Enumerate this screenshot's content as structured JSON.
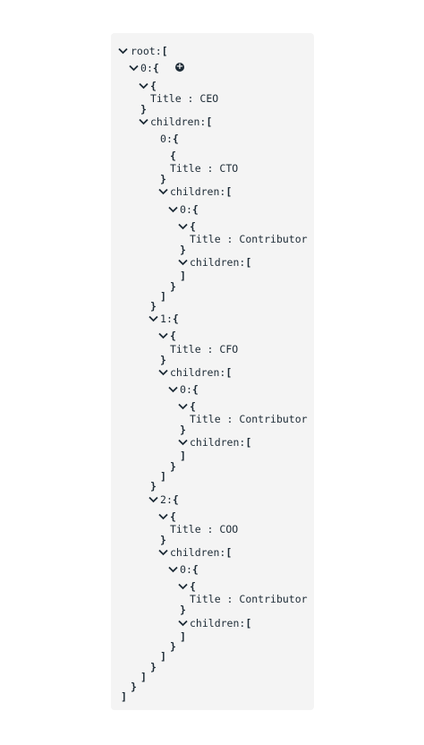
{
  "tree": {
    "root_key": "root",
    "key_sep": ":",
    "open_array": "[",
    "close_array": "]",
    "open_object": "{",
    "close_object": "}",
    "title_key": "Title",
    "title_sep": " : ",
    "children_key": "children",
    "ceo": {
      "index": "0",
      "title": "CEO"
    },
    "reports": [
      {
        "index": "0",
        "title": "CTO",
        "contributor": {
          "index": "0",
          "title": "Contributor"
        }
      },
      {
        "index": "1",
        "title": "CFO",
        "contributor": {
          "index": "0",
          "title": "Contributor"
        }
      },
      {
        "index": "2",
        "title": "COO",
        "contributor": {
          "index": "0",
          "title": "Contributor"
        }
      }
    ],
    "add_icon": "plus-circle-icon",
    "add_glyph": "+"
  }
}
